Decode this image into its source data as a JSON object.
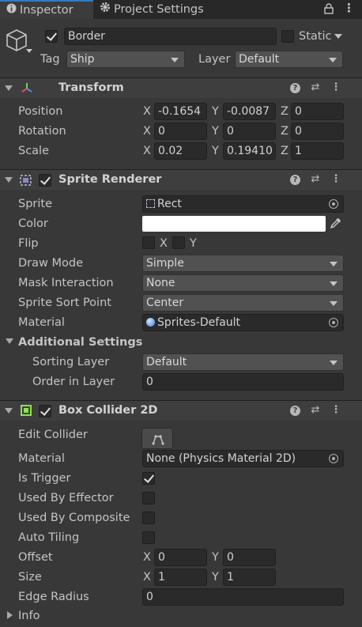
{
  "tabs": [
    {
      "label": "Inspector",
      "icon": "info-icon"
    },
    {
      "label": "Project Settings",
      "icon": "gear-icon"
    }
  ],
  "object": {
    "name": "Border",
    "active": true,
    "static_label": "Static",
    "tag_label": "Tag",
    "tag_value": "Ship",
    "layer_label": "Layer",
    "layer_value": "Default"
  },
  "transform": {
    "title": "Transform",
    "position": {
      "label": "Position",
      "x": "-0.1654",
      "y": "-0.0087",
      "z": "0"
    },
    "rotation": {
      "label": "Rotation",
      "x": "0",
      "y": "0",
      "z": "0"
    },
    "scale": {
      "label": "Scale",
      "x": "0.02",
      "y": "0.19410",
      "z": "1"
    }
  },
  "axes": {
    "x": "X",
    "y": "Y",
    "z": "Z"
  },
  "sprite_renderer": {
    "title": "Sprite Renderer",
    "enabled": true,
    "sprite_label": "Sprite",
    "sprite_value": "Rect",
    "color_label": "Color",
    "color_value": "#ffffff",
    "flip_label": "Flip",
    "flip_x": "X",
    "flip_y": "Y",
    "draw_mode_label": "Draw Mode",
    "draw_mode_value": "Simple",
    "mask_label": "Mask Interaction",
    "mask_value": "None",
    "sort_point_label": "Sprite Sort Point",
    "sort_point_value": "Center",
    "material_label": "Material",
    "material_value": "Sprites-Default",
    "additional_label": "Additional Settings",
    "sorting_layer_label": "Sorting Layer",
    "sorting_layer_value": "Default",
    "order_label": "Order in Layer",
    "order_value": "0"
  },
  "box_collider": {
    "title": "Box Collider 2D",
    "enabled": true,
    "edit_label": "Edit Collider",
    "material_label": "Material",
    "material_value": "None (Physics Material 2D)",
    "trigger_label": "Is Trigger",
    "trigger": true,
    "effector_label": "Used By Effector",
    "effector": false,
    "composite_label": "Used By Composite",
    "composite": false,
    "tiling_label": "Auto Tiling",
    "tiling": false,
    "offset_label": "Offset",
    "offset_x": "0",
    "offset_y": "0",
    "size_label": "Size",
    "size_x": "1",
    "size_y": "1",
    "edge_label": "Edge Radius",
    "edge_value": "0",
    "info_label": "Info"
  },
  "colors": {
    "accent": "#3a79bb",
    "collider_icon": "#8fe34a"
  }
}
